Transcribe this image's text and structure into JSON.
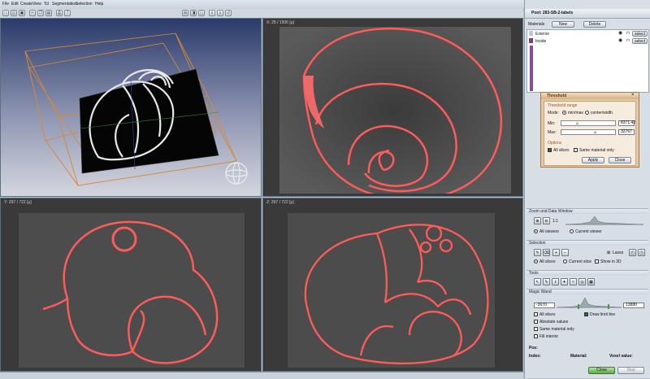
{
  "menu": [
    "File",
    "Edit",
    "Create",
    "View",
    "Tcl",
    "Segmentation",
    "Selection",
    "Help"
  ],
  "toolbar_icons": [
    "new-file-icon",
    "open-icon",
    "save-icon",
    "cut-icon",
    "copy-icon",
    "paste-icon",
    "print-icon",
    "help-icon",
    "layout-4-icon",
    "layout-2-icon",
    "layout-1-icon",
    "layout-x-icon",
    "layout-y-icon",
    "reset-icon"
  ],
  "viewers": {
    "top_right": {
      "label": "X: 25 / 1506 [µ]"
    },
    "bottom_left": {
      "label": "Y: 297 / 722 [µ]"
    },
    "bottom_right": {
      "label": "Z: 297 / 722 [µ]"
    }
  },
  "panel": {
    "title": "Pool: 283-SB-2-labels",
    "materials_label": "Materials",
    "new_button": "New",
    "delete_button": "Delete",
    "materials": [
      {
        "name": "Exterior",
        "color": "#bfc6cc",
        "select": "select"
      },
      {
        "name": "Inside",
        "color": "#7c3a8a",
        "select": "select"
      }
    ],
    "zoom_section": "Zoom and Data Window",
    "zoom_ratio": "1:1",
    "all_viewers": "All viewers",
    "current_viewer": "Current viewer",
    "selection_section": "Selection",
    "lasso": "Lasso",
    "all_slices": "All slices",
    "current_slice": "Current slice",
    "show_in_3d": "Show in 3D",
    "tools_section": "Tools",
    "magic_wand_section": "Magic Wand",
    "wand_min": "-3670",
    "wand_max": "13880",
    "wand_all_slices": "All slices",
    "draw_limit_line": "Draw limit line",
    "absolute_values": "Absolute values",
    "same_material_only": "Same material only",
    "fill_interior": "Fill interior",
    "pos_label": "Pos:",
    "index_label": "Index:",
    "material_label": "Material:",
    "voxel_label": "Voxel value:",
    "close_button": "Close",
    "stop_button": "Stop"
  },
  "threshold_dialog": {
    "title": "Threshold",
    "range_label": "Threshold range",
    "mode_label": "Mode:",
    "mode_minmax": "min/max",
    "mode_center": "center/width",
    "min_label": "Min:",
    "min_value": "8371.42",
    "max_label": "Max:",
    "max_value": "32767",
    "options_label": "Options",
    "all_slices": "All slices",
    "same_material": "Same material only",
    "apply_button": "Apply",
    "close_button": "Close"
  },
  "colors": {
    "contour": "#ff5a5a",
    "accent": "#3f9a3f",
    "panel_bg": "#d7dee6"
  }
}
